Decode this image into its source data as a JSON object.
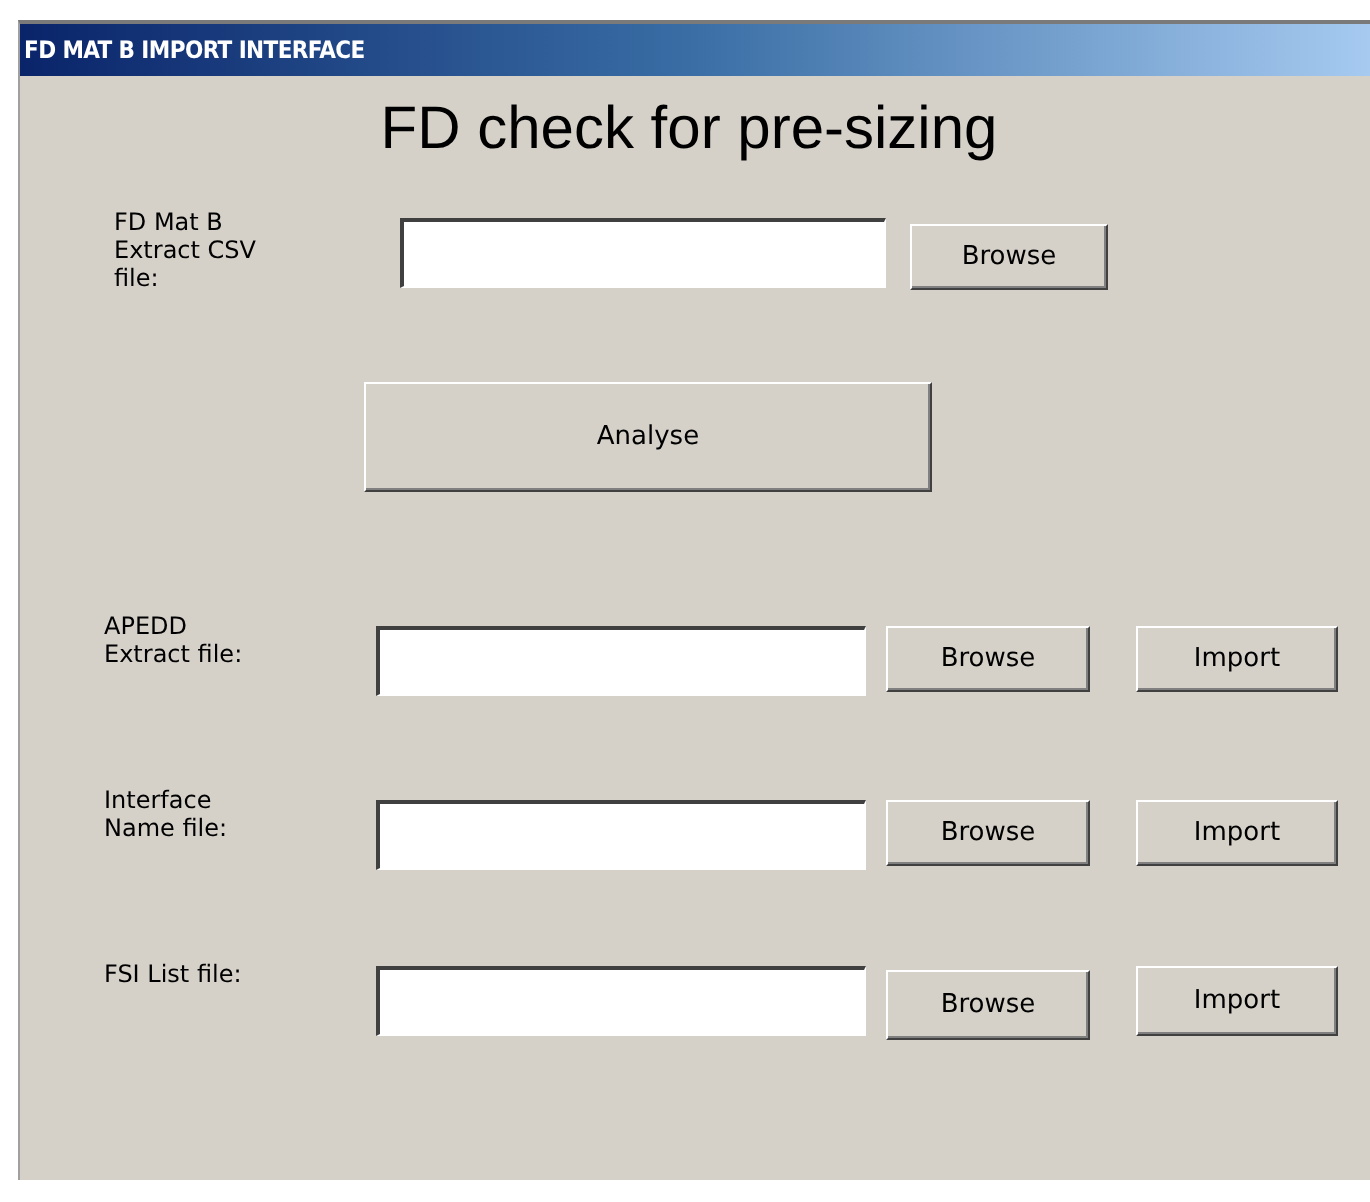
{
  "window": {
    "title": "FD MAT B IMPORT INTERFACE"
  },
  "heading": "FD check for pre-sizing",
  "csv_row": {
    "label": "FD Mat B\nExtract CSV\nfile:",
    "browse": "Browse"
  },
  "analyse_button": "Analyse",
  "import_rows": [
    {
      "label": "APEDD\nExtract file:",
      "browse": "Browse",
      "import": "Import"
    },
    {
      "label": "Interface\nName file:",
      "browse": "Browse",
      "import": "Import"
    },
    {
      "label": "FSI List file:",
      "browse": "Browse",
      "import": "Import"
    }
  ]
}
